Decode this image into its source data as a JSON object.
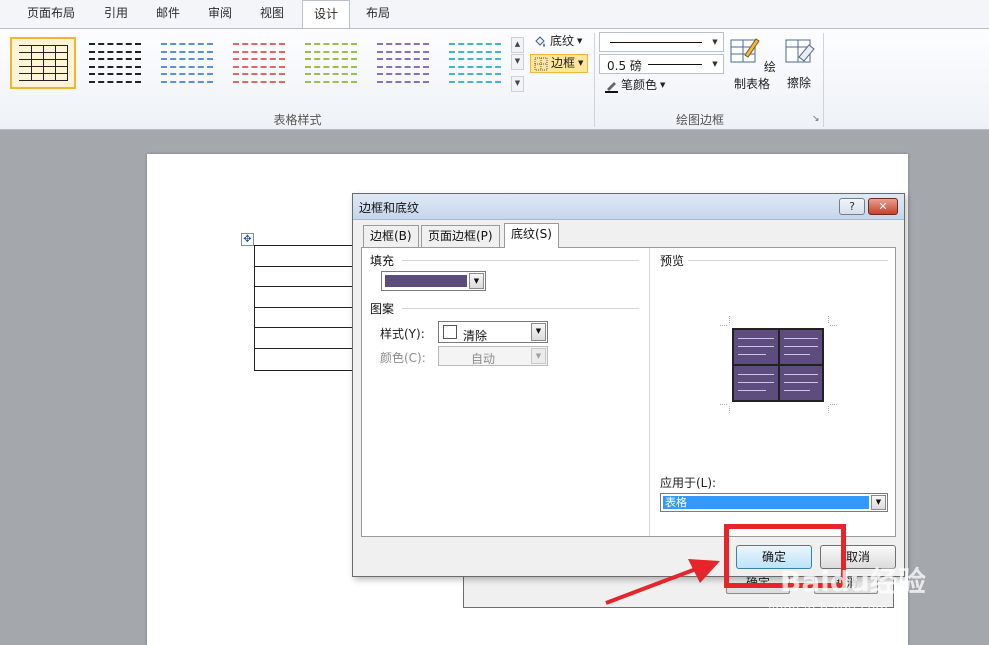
{
  "ribbon": {
    "tabs": [
      {
        "label": "页面布局",
        "active": false
      },
      {
        "label": "引用",
        "active": false
      },
      {
        "label": "邮件",
        "active": false
      },
      {
        "label": "审阅",
        "active": false
      },
      {
        "label": "视图",
        "active": false
      },
      {
        "label": "设计",
        "active": true
      },
      {
        "label": "布局",
        "active": false
      }
    ],
    "styles_group_label": "表格样式",
    "draw_group_label": "绘图边框",
    "shading_label": "底纹",
    "borders_label": "边框",
    "line_weight": "0.5 磅",
    "pen_color_label": "笔颜色",
    "draw_table_label": "绘制表格",
    "eraser_label": "擦除",
    "style_thumb_colors": [
      "#222222",
      "#222222",
      "#5b8fd6",
      "#e06767",
      "#9bbf4f",
      "#8b6fb8",
      "#43b6cf"
    ]
  },
  "dialog": {
    "title": "边框和底纹",
    "help": "?",
    "close": "✕",
    "tabs": [
      {
        "label": "边框(B)",
        "active": false
      },
      {
        "label": "页面边框(P)",
        "active": false
      },
      {
        "label": "底纹(S)",
        "active": true
      }
    ],
    "fill_label": "填充",
    "fill_color": "#5c4d7e",
    "pattern_label": "图案",
    "style_label": "样式(Y):",
    "style_value": "清除",
    "color_label": "颜色(C):",
    "color_value": "自动",
    "preview_label": "预览",
    "apply_to_label": "应用于(L):",
    "apply_to_value": "表格",
    "ok_label": "确定",
    "cancel_label": "取消"
  },
  "background_dialog": {
    "ok_label": "确定",
    "cancel_label": "取消"
  },
  "annotation": {
    "color": "#e5252a"
  },
  "watermark": {
    "text": "Baidu经验",
    "sub": "jingyan.baidu.com"
  }
}
